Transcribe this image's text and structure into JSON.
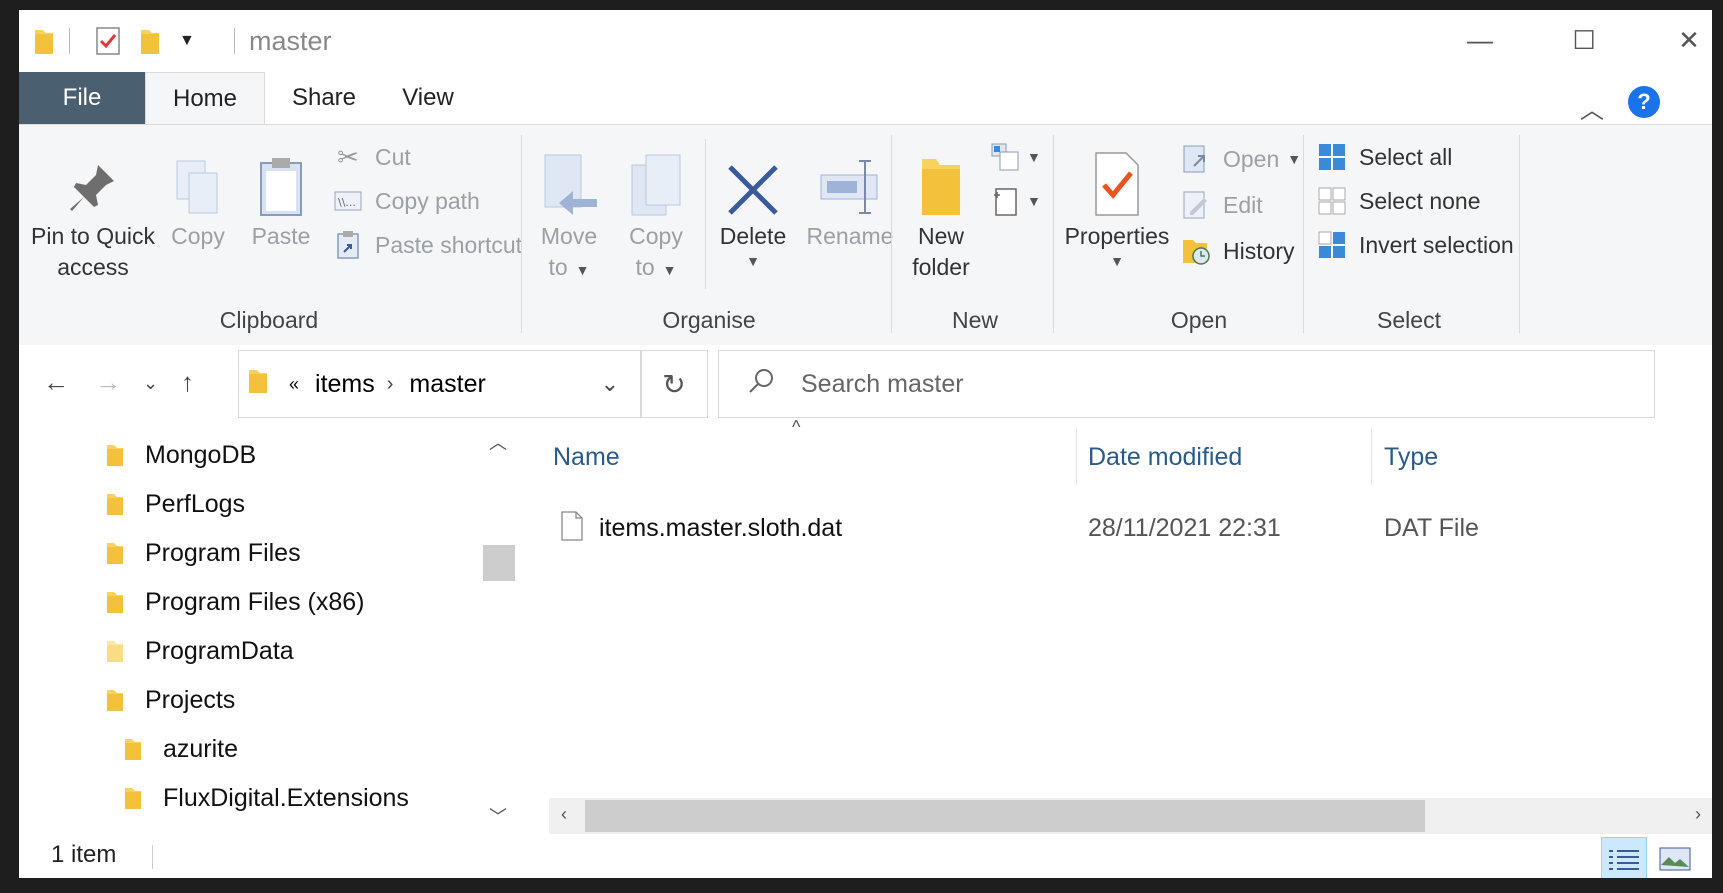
{
  "window": {
    "title": "master",
    "controls": {
      "minimize": "—",
      "maximize": "☐",
      "close": "✕"
    }
  },
  "tabs": [
    {
      "label": "File"
    },
    {
      "label": "Home"
    },
    {
      "label": "Share"
    },
    {
      "label": "View"
    }
  ],
  "help_label": "?",
  "ribbon": {
    "clipboard": {
      "label": "Clipboard",
      "pin_line1": "Pin to Quick",
      "pin_line2": "access",
      "copy": "Copy",
      "paste": "Paste",
      "cut": "Cut",
      "copy_path": "Copy path",
      "paste_shortcut": "Paste shortcut"
    },
    "organise": {
      "label": "Organise",
      "move_line1": "Move",
      "move_line2": "to",
      "copy_line1": "Copy",
      "copy_line2": "to",
      "delete": "Delete",
      "rename": "Rename"
    },
    "new": {
      "label": "New",
      "new_folder_line1": "New",
      "new_folder_line2": "folder"
    },
    "open": {
      "label": "Open",
      "properties": "Properties",
      "open": "Open",
      "edit": "Edit",
      "history": "History"
    },
    "select": {
      "label": "Select",
      "select_all": "Select all",
      "select_none": "Select none",
      "invert": "Invert selection"
    }
  },
  "address": {
    "overflow": "«",
    "crumbs": [
      "items",
      "master"
    ],
    "search_placeholder": "Search master"
  },
  "nav_pane": {
    "items": [
      {
        "label": "MongoDB"
      },
      {
        "label": "PerfLogs"
      },
      {
        "label": "Program Files"
      },
      {
        "label": "Program Files (x86)"
      },
      {
        "label": "ProgramData"
      },
      {
        "label": "Projects"
      },
      {
        "label": "azurite"
      },
      {
        "label": "FluxDigital.Extensions"
      }
    ]
  },
  "files": {
    "columns": [
      "Name",
      "Date modified",
      "Type"
    ],
    "rows": [
      {
        "name": "items.master.sloth.dat",
        "date": "28/11/2021 22:31",
        "type": "DAT File"
      }
    ]
  },
  "status": {
    "count": "1 item"
  },
  "colors": {
    "file_tab": "#4a5f70",
    "folder": "#f8d25c",
    "accent": "#1a73e8",
    "delete": "#3b5a9a"
  }
}
